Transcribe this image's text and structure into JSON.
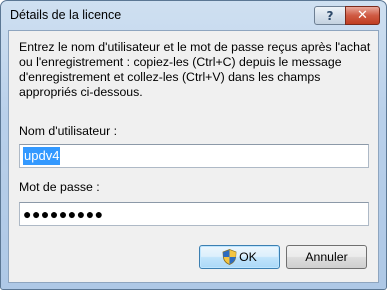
{
  "window": {
    "title": "Détails de la licence",
    "help_label": "?",
    "close_label": "✕"
  },
  "dialog": {
    "instructions": "Entrez le nom d'utilisateur et le mot de passe reçus après l'achat ou l'enregistrement : copiez-les (Ctrl+C) depuis le message d'enregistrement et collez-les (Ctrl+V) dans les champs appropriés ci-dessous.",
    "username_label": "Nom d'utilisateur :",
    "username_value": "updv4",
    "password_label": "Mot de passe :",
    "password_value": "●●●●●●●●●",
    "ok_label": "OK",
    "cancel_label": "Annuler"
  },
  "icons": {
    "ok": "uac-shield-icon"
  }
}
